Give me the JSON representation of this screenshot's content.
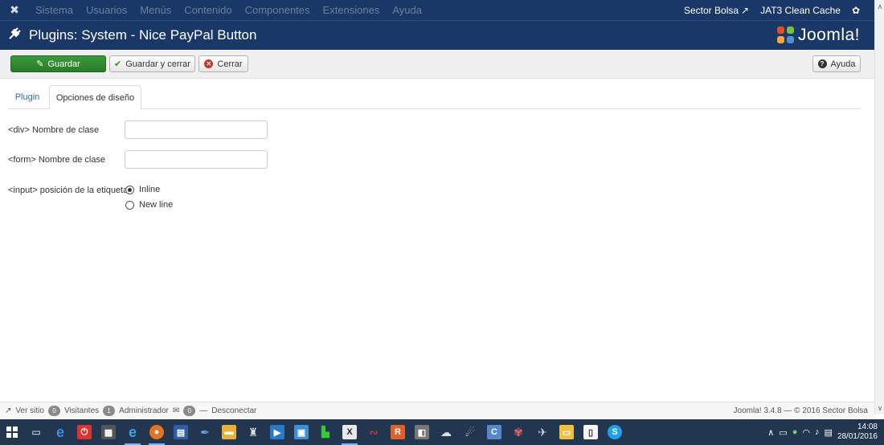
{
  "topnav": {
    "menu": [
      "Sistema",
      "Usuarios",
      "Menús",
      "Contenido",
      "Componentes",
      "Extensiones",
      "Ayuda"
    ],
    "site_link": "Sector Bolsa",
    "cache_label": "JAT3 Clean Cache"
  },
  "title": {
    "text": "Plugins: System - Nice PayPal Button",
    "brand": "Joomla!"
  },
  "toolbar": {
    "save_label": "Guardar",
    "save_close_label": "Guardar y cerrar",
    "close_label": "Cerrar",
    "help_label": "Ayuda"
  },
  "tabs": {
    "plugin": "Plugin",
    "layout_options": "Opciones de diseño"
  },
  "form": {
    "div_class_label": "<div> Nombre de clase",
    "div_class_value": "",
    "form_class_label": "<form> Nombre de clase",
    "form_class_value": "",
    "input_pos_label": "<input> posición de la etiqueta",
    "options": [
      "Inline",
      "New line"
    ],
    "selected": "Inline"
  },
  "status": {
    "view_site": "Ver sitio",
    "visitors_count": "0",
    "visitors_label": "Visitantes",
    "admins_count": "1",
    "admins_label": "Administrador",
    "messages_count": "0",
    "logout": "Desconectar",
    "footer": "Joomla! 3.4.8 — © 2016 Sector Bolsa"
  },
  "clock": {
    "time": "14:08",
    "date": "28/01/2016"
  },
  "colors": {
    "header_bg": "#1a3867",
    "save_green": "#2f8a2f",
    "link_blue": "#2a69b8",
    "taskbar_bg": "#22364f"
  }
}
